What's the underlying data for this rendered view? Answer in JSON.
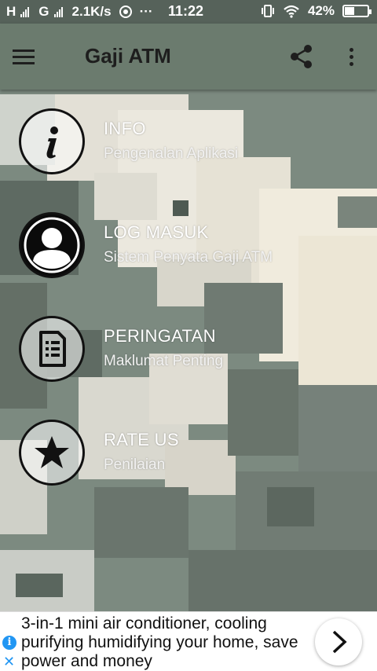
{
  "status_bar": {
    "carrier1": "H",
    "carrier2": "G",
    "speed": "2.1K/s",
    "dots": "···",
    "time": "11:22",
    "battery": "42%",
    "battery_level": 0.42
  },
  "app_bar": {
    "title": "Gaji ATM",
    "menu_icon": "hamburger-icon",
    "share_icon": "share-icon",
    "more_icon": "more-vert-icon"
  },
  "items": [
    {
      "label": "INFO",
      "sub": "Pengenalan Aplikasi",
      "icon": "info-icon"
    },
    {
      "label": "LOG MASUK",
      "sub": "Sistem Penyata Gaji ATM",
      "icon": "user-icon"
    },
    {
      "label": "PERINGATAN",
      "sub": "Maklumat Penting",
      "icon": "document-icon"
    },
    {
      "label": "RATE US",
      "sub": "Penilaian",
      "icon": "star-icon"
    }
  ],
  "ad": {
    "text": "3-in-1 mini air conditioner, cooling purifying humidifying your home, save power and money",
    "info_glyph": "i",
    "close_glyph": "✕"
  },
  "colors": {
    "status_bar": "#56625a",
    "app_bar": "#6b7b6e",
    "ad_icon": "#2196f3"
  }
}
